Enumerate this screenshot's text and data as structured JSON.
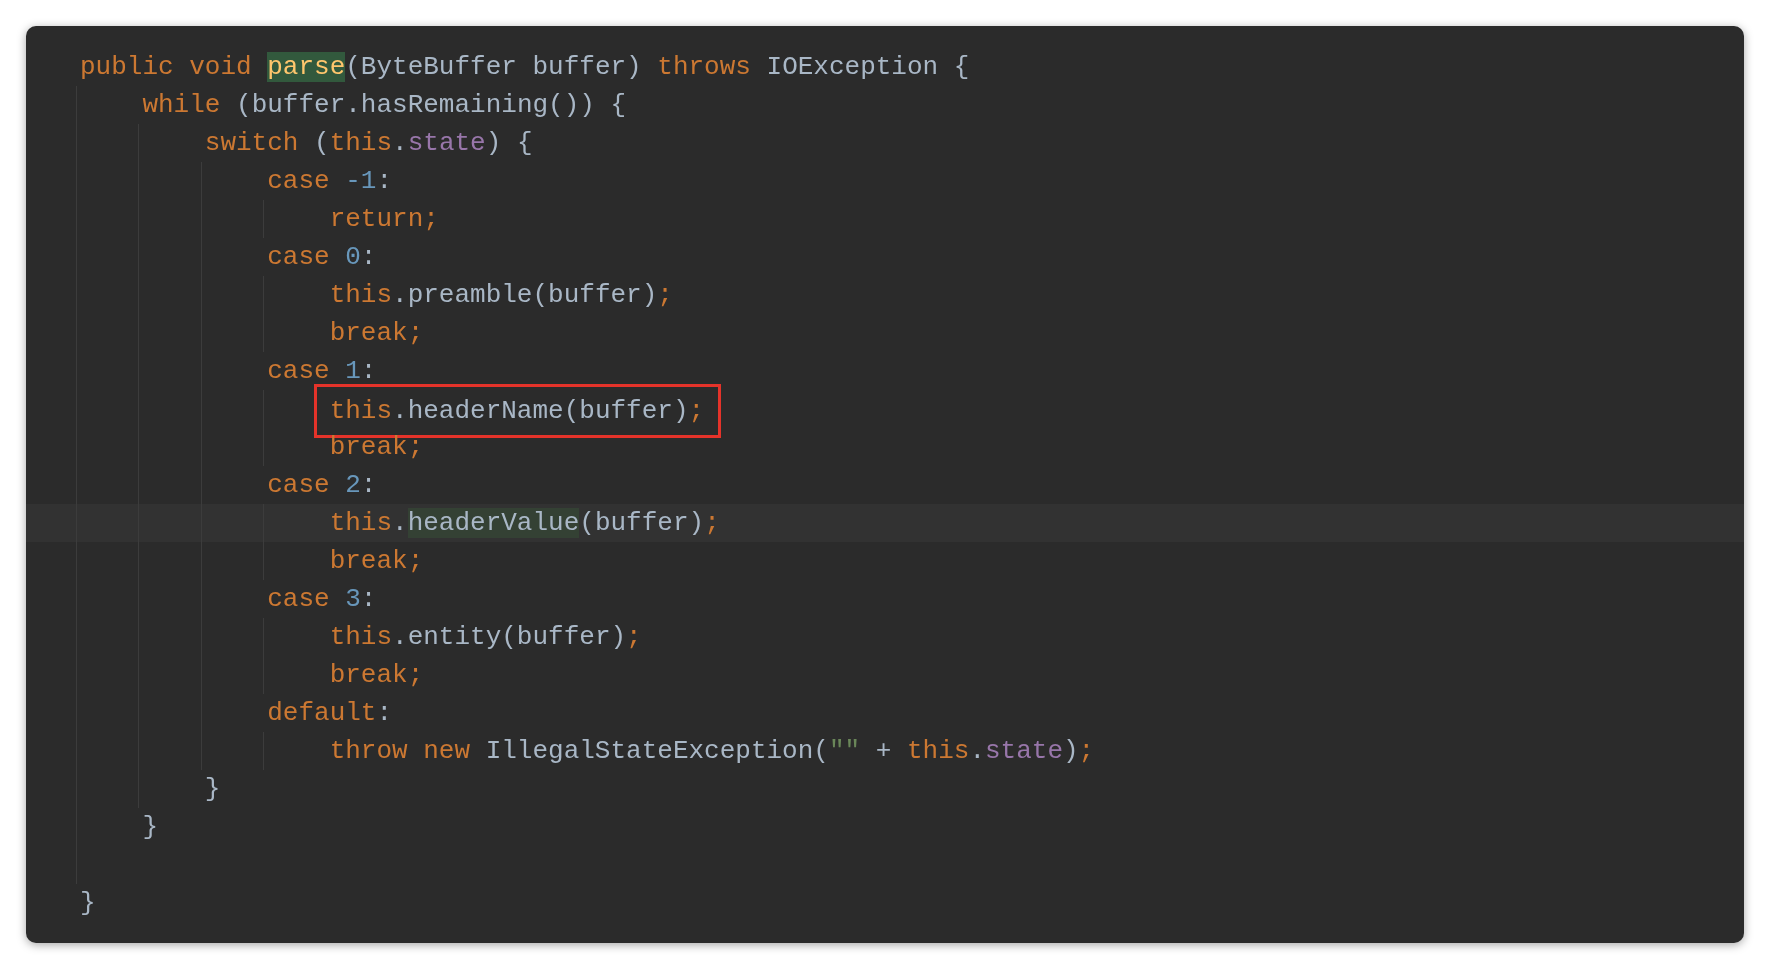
{
  "editor": {
    "lines": [
      {
        "tokens": [
          {
            "text": "public void ",
            "kind": "keyword"
          },
          {
            "text": "parse",
            "kind": "declaration"
          },
          {
            "text": "(ByteBuffer buffer) ",
            "kind": "plain"
          },
          {
            "text": "throws ",
            "kind": "keyword"
          },
          {
            "text": "IOException {",
            "kind": "plain"
          }
        ],
        "children": [
          {
            "tokens": [
              {
                "text": "while ",
                "kind": "keyword"
              },
              {
                "text": "(buffer.hasRemaining()) {",
                "kind": "plain"
              }
            ],
            "children": [
              {
                "tokens": [
                  {
                    "text": "switch ",
                    "kind": "keyword"
                  },
                  {
                    "text": "(",
                    "kind": "plain"
                  },
                  {
                    "text": "this",
                    "kind": "keyword"
                  },
                  {
                    "text": ".",
                    "kind": "plain"
                  },
                  {
                    "text": "state",
                    "kind": "field"
                  },
                  {
                    "text": ") {",
                    "kind": "plain"
                  }
                ],
                "children": [
                  {
                    "tokens": [
                      {
                        "text": "case ",
                        "kind": "keyword"
                      },
                      {
                        "text": "-1",
                        "kind": "number"
                      },
                      {
                        "text": ":",
                        "kind": "plain"
                      }
                    ],
                    "children": [
                      {
                        "tokens": [
                          {
                            "text": "return;",
                            "kind": "keyword"
                          }
                        ]
                      }
                    ]
                  },
                  {
                    "tokens": [
                      {
                        "text": "case ",
                        "kind": "keyword"
                      },
                      {
                        "text": "0",
                        "kind": "number"
                      },
                      {
                        "text": ":",
                        "kind": "plain"
                      }
                    ],
                    "children": [
                      {
                        "tokens": [
                          {
                            "text": "this",
                            "kind": "keyword"
                          },
                          {
                            "text": ".preamble(buffer)",
                            "kind": "plain"
                          },
                          {
                            "text": ";",
                            "kind": "keyword"
                          }
                        ]
                      },
                      {
                        "tokens": [
                          {
                            "text": "break;",
                            "kind": "keyword"
                          }
                        ]
                      }
                    ]
                  },
                  {
                    "tokens": [
                      {
                        "text": "case ",
                        "kind": "keyword"
                      },
                      {
                        "text": "1",
                        "kind": "number"
                      },
                      {
                        "text": ":",
                        "kind": "plain"
                      }
                    ],
                    "children": [
                      {
                        "boxed": true,
                        "tokens": [
                          {
                            "text": "this",
                            "kind": "keyword"
                          },
                          {
                            "text": ".headerName(buffer)",
                            "kind": "plain"
                          },
                          {
                            "text": ";",
                            "kind": "keyword"
                          }
                        ]
                      },
                      {
                        "tokens": [
                          {
                            "text": "break;",
                            "kind": "keyword"
                          }
                        ]
                      }
                    ]
                  },
                  {
                    "tokens": [
                      {
                        "text": "case ",
                        "kind": "keyword"
                      },
                      {
                        "text": "2",
                        "kind": "number"
                      },
                      {
                        "text": ":",
                        "kind": "plain"
                      }
                    ],
                    "children": [
                      {
                        "current": true,
                        "tokens": [
                          {
                            "text": "this",
                            "kind": "keyword"
                          },
                          {
                            "text": ".",
                            "kind": "plain"
                          },
                          {
                            "text": "headerValue",
                            "kind": "usage"
                          },
                          {
                            "text": "(buffer)",
                            "kind": "plain"
                          },
                          {
                            "text": ";",
                            "kind": "keyword"
                          }
                        ]
                      },
                      {
                        "tokens": [
                          {
                            "text": "break;",
                            "kind": "keyword"
                          }
                        ]
                      }
                    ]
                  },
                  {
                    "tokens": [
                      {
                        "text": "case ",
                        "kind": "keyword"
                      },
                      {
                        "text": "3",
                        "kind": "number"
                      },
                      {
                        "text": ":",
                        "kind": "plain"
                      }
                    ],
                    "children": [
                      {
                        "tokens": [
                          {
                            "text": "this",
                            "kind": "keyword"
                          },
                          {
                            "text": ".entity(buffer)",
                            "kind": "plain"
                          },
                          {
                            "text": ";",
                            "kind": "keyword"
                          }
                        ]
                      },
                      {
                        "tokens": [
                          {
                            "text": "break;",
                            "kind": "keyword"
                          }
                        ]
                      }
                    ]
                  },
                  {
                    "tokens": [
                      {
                        "text": "default",
                        "kind": "keyword"
                      },
                      {
                        "text": ":",
                        "kind": "plain"
                      }
                    ],
                    "children": [
                      {
                        "tokens": [
                          {
                            "text": "throw new ",
                            "kind": "keyword"
                          },
                          {
                            "text": "IllegalStateException(",
                            "kind": "plain"
                          },
                          {
                            "text": "\"\"",
                            "kind": "string"
                          },
                          {
                            "text": " + ",
                            "kind": "plain"
                          },
                          {
                            "text": "this",
                            "kind": "keyword"
                          },
                          {
                            "text": ".",
                            "kind": "plain"
                          },
                          {
                            "text": "state",
                            "kind": "field"
                          },
                          {
                            "text": ")",
                            "kind": "plain"
                          },
                          {
                            "text": ";",
                            "kind": "keyword"
                          }
                        ]
                      }
                    ]
                  }
                ]
              },
              {
                "tokens": [
                  {
                    "text": "}",
                    "kind": "plain"
                  }
                ]
              }
            ]
          },
          {
            "tokens": [
              {
                "text": "}",
                "kind": "plain"
              }
            ]
          },
          {
            "kind": "blank"
          }
        ]
      },
      {
        "tokens": [
          {
            "text": "}",
            "kind": "plain"
          }
        ]
      }
    ]
  }
}
